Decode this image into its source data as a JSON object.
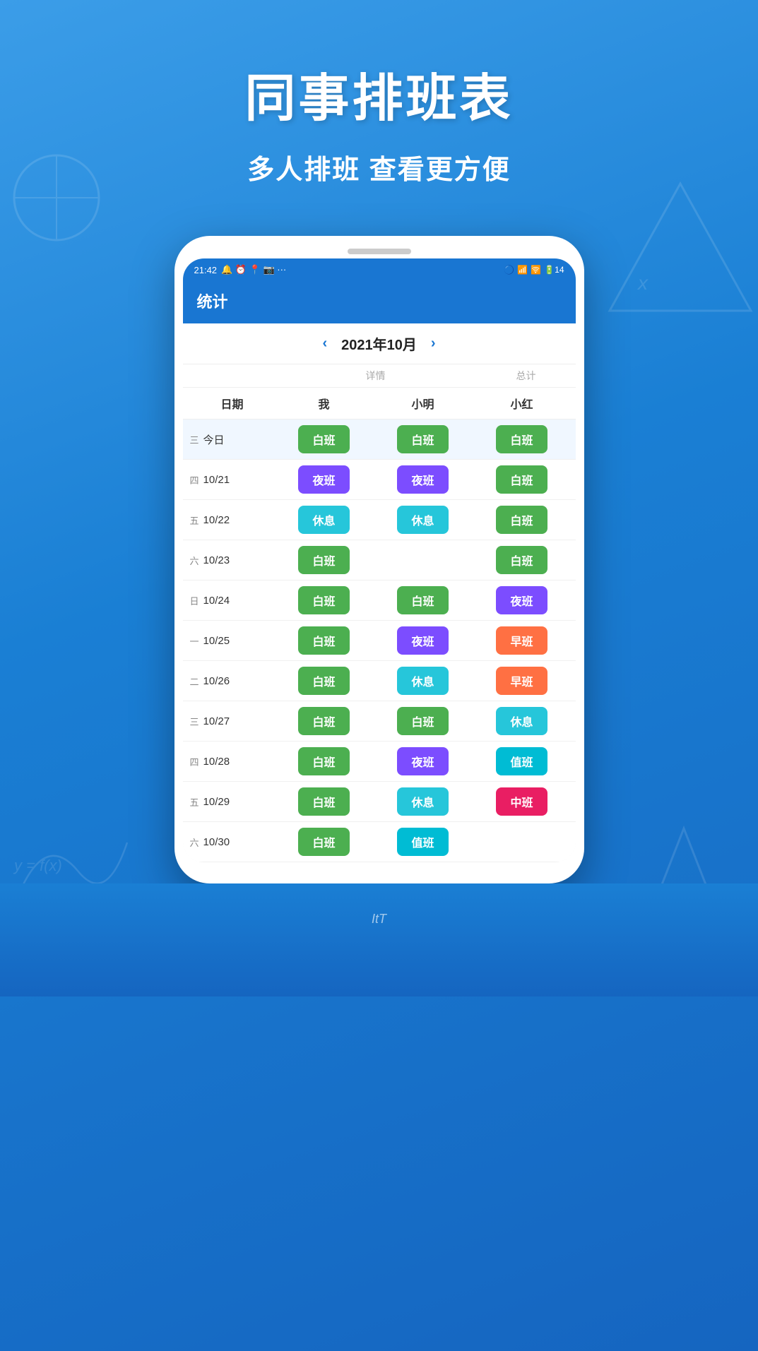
{
  "page": {
    "bg_color_top": "#3b9de8",
    "bg_color_bottom": "#1565c0"
  },
  "header": {
    "main_title": "同事排班表",
    "sub_title": "多人排班 查看更方便"
  },
  "status_bar": {
    "time": "21:42",
    "icons_left": "🔔 ⏰ 📍 📷 📷 ···",
    "icons_right": "🔵 📶 📶 🛜 🔋"
  },
  "app_title": "统计",
  "calendar": {
    "month": "2021年10月",
    "prev_arrow": "‹",
    "next_arrow": "›"
  },
  "subheaders": {
    "detail": "详情",
    "total": "总计"
  },
  "table_headers": {
    "date": "日期",
    "me": "我",
    "xiaoming": "小明",
    "xiaohong": "小红"
  },
  "rows": [
    {
      "day_of_week": "三",
      "date": "今日",
      "me": {
        "label": "白班",
        "type": "white"
      },
      "xiaoming": {
        "label": "白班",
        "type": "white"
      },
      "xiaohong": {
        "label": "白班",
        "type": "white"
      },
      "highlighted": true
    },
    {
      "day_of_week": "四",
      "date": "10/21",
      "me": {
        "label": "夜班",
        "type": "night"
      },
      "xiaoming": {
        "label": "夜班",
        "type": "night"
      },
      "xiaohong": {
        "label": "白班",
        "type": "white"
      }
    },
    {
      "day_of_week": "五",
      "date": "10/22",
      "me": {
        "label": "休息",
        "type": "rest"
      },
      "xiaoming": {
        "label": "休息",
        "type": "rest"
      },
      "xiaohong": {
        "label": "白班",
        "type": "white"
      }
    },
    {
      "day_of_week": "六",
      "date": "10/23",
      "me": {
        "label": "白班",
        "type": "white"
      },
      "xiaoming": {
        "label": "",
        "type": "none"
      },
      "xiaohong": {
        "label": "白班",
        "type": "white"
      }
    },
    {
      "day_of_week": "日",
      "date": "10/24",
      "me": {
        "label": "白班",
        "type": "white"
      },
      "xiaoming": {
        "label": "白班",
        "type": "white"
      },
      "xiaohong": {
        "label": "夜班",
        "type": "night"
      }
    },
    {
      "day_of_week": "一",
      "date": "10/25",
      "me": {
        "label": "白班",
        "type": "white"
      },
      "xiaoming": {
        "label": "夜班",
        "type": "night"
      },
      "xiaohong": {
        "label": "早班",
        "type": "early"
      }
    },
    {
      "day_of_week": "二",
      "date": "10/26",
      "me": {
        "label": "白班",
        "type": "white"
      },
      "xiaoming": {
        "label": "休息",
        "type": "rest"
      },
      "xiaohong": {
        "label": "早班",
        "type": "early"
      }
    },
    {
      "day_of_week": "三",
      "date": "10/27",
      "me": {
        "label": "白班",
        "type": "white"
      },
      "xiaoming": {
        "label": "白班",
        "type": "white"
      },
      "xiaohong": {
        "label": "休息",
        "type": "rest"
      }
    },
    {
      "day_of_week": "四",
      "date": "10/28",
      "me": {
        "label": "白班",
        "type": "white"
      },
      "xiaoming": {
        "label": "夜班",
        "type": "night"
      },
      "xiaohong": {
        "label": "值班",
        "type": "value"
      }
    },
    {
      "day_of_week": "五",
      "date": "10/29",
      "me": {
        "label": "白班",
        "type": "white"
      },
      "xiaoming": {
        "label": "休息",
        "type": "rest"
      },
      "xiaohong": {
        "label": "中班",
        "type": "mid"
      }
    },
    {
      "day_of_week": "六",
      "date": "10/30",
      "me": {
        "label": "白班",
        "type": "white"
      },
      "xiaoming": {
        "label": "值班",
        "type": "value"
      },
      "xiaohong": {
        "label": "",
        "type": "none"
      }
    }
  ],
  "bottom_text": "ItT"
}
